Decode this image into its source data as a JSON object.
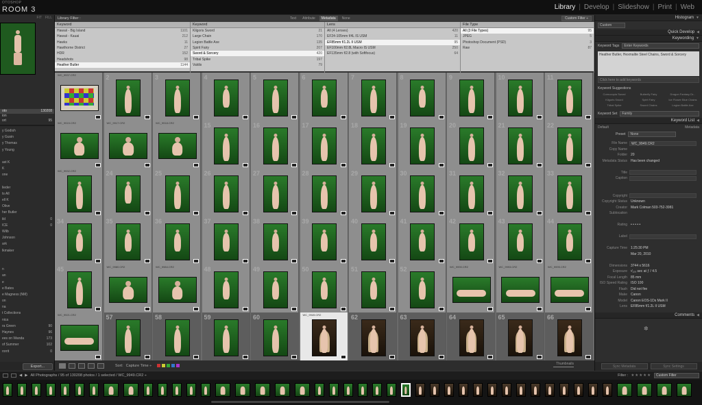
{
  "identity": {
    "app_small": "OTOSHOP",
    "app_big": "ROOM 3"
  },
  "modules": [
    {
      "label": "Library",
      "active": true
    },
    {
      "label": "Develop",
      "active": false
    },
    {
      "label": "Slideshow",
      "active": false
    },
    {
      "label": "Print",
      "active": false
    },
    {
      "label": "Web",
      "active": false
    }
  ],
  "navigator": {
    "header": [
      "FIT",
      "FILL"
    ]
  },
  "catalog": [
    {
      "label": "oto",
      "count": "130208",
      "selected": true
    },
    {
      "label": "ion",
      "count": "",
      "selected": false
    },
    {
      "label": "ort",
      "count": "95",
      "selected": false
    }
  ],
  "collections": [
    {
      "label": "y Godish",
      "count": ""
    },
    {
      "label": "y Gusin",
      "count": ""
    },
    {
      "label": "y Thomas",
      "count": ""
    },
    {
      "label": "y Young",
      "count": ""
    },
    {
      "label": "",
      "count": ""
    },
    {
      "label": "ast K",
      "count": ""
    },
    {
      "label": "K",
      "count": ""
    },
    {
      "label": "one",
      "count": ""
    },
    {
      "label": "",
      "count": ""
    },
    {
      "label": "lieder",
      "count": ""
    },
    {
      "label": "ts All",
      "count": ""
    },
    {
      "label": "ell K",
      "count": ""
    },
    {
      "label": "Olive",
      "count": ""
    },
    {
      "label": "her Butler",
      "count": ""
    },
    {
      "label": "ild",
      "count": "0"
    },
    {
      "label": "ICE",
      "count": "0"
    },
    {
      "label": "Wilb",
      "count": ""
    },
    {
      "label": "Johnson",
      "count": ""
    },
    {
      "label": "ark",
      "count": ""
    },
    {
      "label": "lkmaker",
      "count": ""
    },
    {
      "label": "",
      "count": ""
    },
    {
      "label": "",
      "count": ""
    },
    {
      "label": "n",
      "count": ""
    },
    {
      "label": "an",
      "count": ""
    },
    {
      "label": "e",
      "count": ""
    },
    {
      "label": "e Bates",
      "count": ""
    },
    {
      "label": "e Magness (NM)",
      "count": ""
    },
    {
      "label": "on",
      "count": ""
    },
    {
      "label": "na",
      "count": ""
    },
    {
      "label": "t Collections",
      "count": ""
    },
    {
      "label": "nica",
      "count": ""
    },
    {
      "label": "ra Green",
      "count": "90"
    },
    {
      "label": "Haynes",
      "count": "96"
    },
    {
      "label": "ees on Wanda",
      "count": "173"
    },
    {
      "label": "of Summer",
      "count": "102"
    },
    {
      "label": "rorrit",
      "count": "0"
    }
  ],
  "export_label": "Export...",
  "filter_bar": {
    "title": "Library Filter :",
    "tabs": [
      {
        "label": "Text",
        "active": false
      },
      {
        "label": "Attribute",
        "active": false
      },
      {
        "label": "Metadata",
        "active": true
      },
      {
        "label": "None",
        "active": false
      }
    ],
    "custom": "Custom Filter ÷"
  },
  "filter_columns": [
    {
      "header": "Keyword",
      "rows": [
        {
          "label": "Hawaii - Big Island",
          "count": "1101"
        },
        {
          "label": "Hawaii - Kauai",
          "count": "212"
        },
        {
          "label": "Hawks",
          "count": "11"
        },
        {
          "label": "Hawthorne District",
          "count": "27"
        },
        {
          "label": "HDR",
          "count": "152"
        },
        {
          "label": "Headshots",
          "count": "98"
        },
        {
          "label": "Heather Butler",
          "count": "1144",
          "selected": true
        }
      ]
    },
    {
      "header": "Keyword",
      "rows": [
        {
          "label": "Kilgoris Sword",
          "count": "21"
        },
        {
          "label": "Large Chain",
          "count": "170"
        },
        {
          "label": "Legion Battle Axe",
          "count": "135"
        },
        {
          "label": "Spirit Fairy",
          "count": "207"
        },
        {
          "label": "Sword & Sorcery",
          "count": "420",
          "selected": true
        },
        {
          "label": "Tribal Spike",
          "count": "197"
        },
        {
          "label": "Valdis",
          "count": "79"
        }
      ]
    },
    {
      "header": "Lens",
      "rows": [
        {
          "label": "All (4 Lenses)",
          "count": "420"
        },
        {
          "label": "EF24-105mm f/4L IS USM",
          "count": "11"
        },
        {
          "label": "EF85mm f/1.2L II USM",
          "count": "95",
          "selected": true
        },
        {
          "label": "EF100mm f/2.8L Macro IS USM",
          "count": "250"
        },
        {
          "label": "EF135mm f/2.8 (with Softfocus)",
          "count": "64"
        }
      ]
    },
    {
      "header": "File Type",
      "rows": [
        {
          "label": "All (3 File Types)",
          "count": "95",
          "selected": true
        },
        {
          "label": "JPEG",
          "count": "5"
        },
        {
          "label": "Photoshop Document (PSD)",
          "count": "3"
        },
        {
          "label": "Raw",
          "count": "87"
        }
      ]
    }
  ],
  "grid": {
    "rows": [
      {
        "cells": [
          {
            "num": "",
            "name": "WC_9937.CR2",
            "kind": "checker",
            "wide": true
          },
          {
            "num": "2",
            "name": "",
            "kind": "green-stand"
          },
          {
            "num": "3",
            "name": "",
            "kind": "green-stand"
          },
          {
            "num": "4",
            "name": "",
            "kind": "green-sit"
          },
          {
            "num": "5",
            "name": "",
            "kind": "green-stand"
          },
          {
            "num": "6",
            "name": "",
            "kind": "green-sit"
          },
          {
            "num": "7",
            "name": "",
            "kind": "green-stand"
          },
          {
            "num": "8",
            "name": "",
            "kind": "green-sit"
          },
          {
            "num": "9",
            "name": "",
            "kind": "green-stand"
          },
          {
            "num": "10",
            "name": "",
            "kind": "green-stand"
          },
          {
            "num": "11",
            "name": "",
            "kind": "green-stand"
          }
        ]
      },
      {
        "cells": [
          {
            "num": "",
            "name": "WC_9915.CR2",
            "kind": "green-sit",
            "wide": true
          },
          {
            "num": "",
            "name": "WC_9917.CR2",
            "kind": "green-sit",
            "wide": true
          },
          {
            "num": "",
            "name": "WC_9918.CR2",
            "kind": "green-sit",
            "wide": true
          },
          {
            "num": "15",
            "name": "",
            "kind": "green-stand"
          },
          {
            "num": "16",
            "name": "",
            "kind": "green-stand"
          },
          {
            "num": "17",
            "name": "",
            "kind": "green-stand"
          },
          {
            "num": "18",
            "name": "",
            "kind": "green-stand"
          },
          {
            "num": "19",
            "name": "",
            "kind": "green-stand"
          },
          {
            "num": "20",
            "name": "",
            "kind": "green-stand"
          },
          {
            "num": "21",
            "name": "",
            "kind": "green-stand"
          },
          {
            "num": "22",
            "name": "",
            "kind": "green-stand"
          }
        ]
      },
      {
        "cells": [
          {
            "num": "",
            "name": "WC_9932.CR2",
            "kind": "green-stand"
          },
          {
            "num": "24",
            "name": "",
            "kind": "green-sit"
          },
          {
            "num": "25",
            "name": "",
            "kind": "green-stand"
          },
          {
            "num": "26",
            "name": "",
            "kind": "green-stand"
          },
          {
            "num": "27",
            "name": "",
            "kind": "green-stand"
          },
          {
            "num": "28",
            "name": "",
            "kind": "green-stand"
          },
          {
            "num": "29",
            "name": "",
            "kind": "green-stand"
          },
          {
            "num": "30",
            "name": "",
            "kind": "green-stand"
          },
          {
            "num": "31",
            "name": "",
            "kind": "green-stand"
          },
          {
            "num": "32",
            "name": "",
            "kind": "green-stand"
          },
          {
            "num": "33",
            "name": "",
            "kind": "green-stand"
          }
        ]
      },
      {
        "cells": [
          {
            "num": "34",
            "name": "",
            "kind": "green-sit"
          },
          {
            "num": "35",
            "name": "",
            "kind": "green-sit"
          },
          {
            "num": "36",
            "name": "",
            "kind": "green-sit"
          },
          {
            "num": "37",
            "name": "",
            "kind": "green-sit"
          },
          {
            "num": "38",
            "name": "",
            "kind": "green-sit"
          },
          {
            "num": "39",
            "name": "",
            "kind": "green-sit"
          },
          {
            "num": "40",
            "name": "",
            "kind": "green-sit"
          },
          {
            "num": "41",
            "name": "",
            "kind": "green-sit"
          },
          {
            "num": "42",
            "name": "",
            "kind": "green-sit"
          },
          {
            "num": "43",
            "name": "",
            "kind": "green-sit"
          },
          {
            "num": "44",
            "name": "",
            "kind": "green-sit"
          }
        ]
      },
      {
        "cells": [
          {
            "num": "45",
            "name": "",
            "kind": "green-stand"
          },
          {
            "num": "",
            "name": "WC_9980.CR2",
            "kind": "green-sit",
            "wide": true
          },
          {
            "num": "",
            "name": "WC_9984.CR2",
            "kind": "green-sit",
            "wide": true
          },
          {
            "num": "48",
            "name": "",
            "kind": "green-sit"
          },
          {
            "num": "49",
            "name": "",
            "kind": "green-sit"
          },
          {
            "num": "50",
            "name": "",
            "kind": "green-sit"
          },
          {
            "num": "51",
            "name": "",
            "kind": "green-sit"
          },
          {
            "num": "52",
            "name": "",
            "kind": "green-sit"
          },
          {
            "num": "",
            "name": "WC_9990.CR2",
            "kind": "green-recline",
            "wide": true
          },
          {
            "num": "",
            "name": "WC_9993.CR2",
            "kind": "green-recline",
            "wide": true
          },
          {
            "num": "",
            "name": "WC_9995.CR2",
            "kind": "green-recline",
            "wide": true
          }
        ]
      },
      {
        "cells": [
          {
            "num": "",
            "name": "WC_9921.CR2",
            "kind": "green-recline",
            "wide": true
          },
          {
            "num": "57",
            "name": "",
            "kind": "green-stand",
            "dark": true
          },
          {
            "num": "58",
            "name": "",
            "kind": "green-stand",
            "dark": true
          },
          {
            "num": "59",
            "name": "",
            "kind": "green-stand",
            "dark": true
          },
          {
            "num": "60",
            "name": "",
            "kind": "green-stand",
            "dark": true
          },
          {
            "num": "",
            "name": "WC_9949.CR2",
            "kind": "brown-robe",
            "selected": true
          },
          {
            "num": "62",
            "name": "",
            "kind": "brown-robe",
            "dark": true
          },
          {
            "num": "63",
            "name": "",
            "kind": "brown-robe",
            "dark": true
          },
          {
            "num": "64",
            "name": "",
            "kind": "brown-robe",
            "dark": true
          },
          {
            "num": "65",
            "name": "",
            "kind": "brown-robe",
            "dark": true
          },
          {
            "num": "66",
            "name": "",
            "kind": "brown-robe",
            "dark": true
          }
        ]
      }
    ]
  },
  "toolbar": {
    "sort_label": "Sort:",
    "sort_value": "Capture Time ÷",
    "thumbs_label": "Thumbnails",
    "swatches": [
      "#c33",
      "#cc3",
      "#3a3",
      "#37c",
      "#a3c"
    ]
  },
  "right_panel": {
    "histogram": "Histogram",
    "quick_develop": "Quick Develop",
    "qd_preset": "Custom",
    "keywording": "Keywording",
    "kw_tags_label": "Keyword Tags",
    "kw_tags_value": "Enter Keywords",
    "kw_text": "Heather Butler, Hexmalite Steel Chains, Sword & Sorcery",
    "kw_add": "Click here to add keywords",
    "suggestions_label": "Keyword Suggestions",
    "suggestions": [
      "Cornucopia Sword",
      "Butterfly Fairy",
      "Dragon Fantasy Dr...",
      "Kilgoris Sword",
      "Spirit Fairy",
      "Ice Flower Blue Chains",
      "Tribal Spike",
      "Sword Chains",
      "Legion Battle Axe"
    ],
    "kw_set_label": "Keyword Set",
    "kw_set_value": "Family",
    "keyword_list": "Keyword List",
    "metadata": "Metadata",
    "md_default": "Default",
    "md_preset_label": "Preset",
    "md_preset_value": "None",
    "md_rows": [
      {
        "k": "File Name",
        "v": "WC_9949.CR2",
        "box": true
      },
      {
        "k": "Copy Name",
        "v": "",
        "box": false
      },
      {
        "k": "Folder",
        "v": "20",
        "box": false
      },
      {
        "k": "Metadata Status",
        "v": "Has been changed",
        "box": false
      },
      {
        "k": "",
        "v": "",
        "box": false
      },
      {
        "k": "Title",
        "v": "",
        "box": true
      },
      {
        "k": "Caption",
        "v": "",
        "box": true
      },
      {
        "k": "",
        "v": "",
        "box": false
      },
      {
        "k": "",
        "v": "",
        "box": false
      },
      {
        "k": "Copyright",
        "v": "",
        "box": true
      },
      {
        "k": "Copyright Status",
        "v": "Unknown",
        "box": false
      },
      {
        "k": "Creator",
        "v": "Mark Colman 503-752-3981",
        "box": false
      },
      {
        "k": "Sublocation",
        "v": "",
        "box": false
      },
      {
        "k": "",
        "v": "",
        "box": false
      },
      {
        "k": "Rating",
        "v": "• • • • •",
        "box": false
      },
      {
        "k": "",
        "v": "",
        "box": false
      },
      {
        "k": "Label",
        "v": "",
        "box": true
      },
      {
        "k": "",
        "v": "",
        "box": false
      },
      {
        "k": "Capture Time",
        "v": "1:25:30 PM",
        "box": false
      },
      {
        "k": "",
        "v": "Mar 20, 2010",
        "box": false
      },
      {
        "k": "",
        "v": "",
        "box": false
      },
      {
        "k": "Dimensions",
        "v": "3744 x 5616",
        "box": false
      },
      {
        "k": "Exposure",
        "v": "¹⁄₁₂₅ sec at ƒ / 4.5",
        "box": false
      },
      {
        "k": "Focal Length",
        "v": "85 mm",
        "box": false
      },
      {
        "k": "ISO Speed Rating",
        "v": "ISO 100",
        "box": false
      },
      {
        "k": "Flash",
        "v": "Did not fire",
        "box": false
      },
      {
        "k": "Make",
        "v": "Canon",
        "box": false
      },
      {
        "k": "Model",
        "v": "Canon EOS-1Ds Mark II",
        "box": false
      },
      {
        "k": "Lens",
        "v": "EF85mm f/1.2L II USM",
        "box": false
      }
    ],
    "comments": "Comments",
    "sync_metadata": "Sync Metadata",
    "sync_settings": "Sync Settings"
  },
  "status_bar": {
    "path": "All Photographs / 95 of 130208 photos / 1 selected / WC_9949.CR2 ÷",
    "filter_label": "Filter :",
    "stars": "★★★★★",
    "custom_filter": "Custom Filter"
  }
}
